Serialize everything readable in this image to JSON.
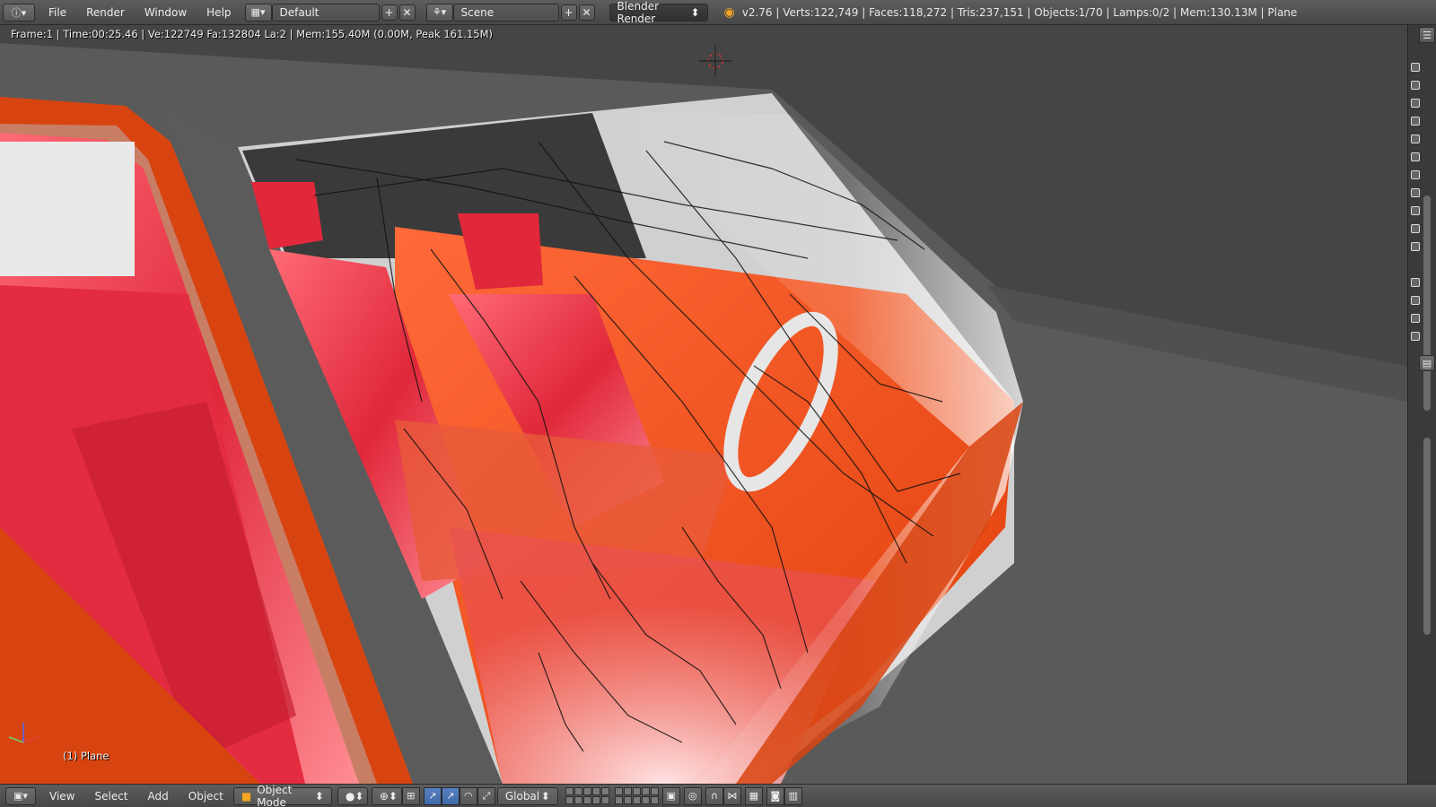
{
  "topbar": {
    "menus": [
      "File",
      "Render",
      "Window",
      "Help"
    ],
    "layout_name": "Default",
    "scene_name": "Scene",
    "engine": "Blender Render",
    "stats": "v2.76 | Verts:122,749 | Faces:118,272 | Tris:237,151 | Objects:1/70 | Lamps:0/2 | Mem:130.13M | Plane"
  },
  "viewport": {
    "render_info": "Frame:1 | Time:00:25.46 | Ve:122749 Fa:132804 La:2 | Mem:155.40M (0.00M, Peak 161.15M)",
    "object_label": "(1) Plane"
  },
  "bottombar": {
    "menus": [
      "View",
      "Select",
      "Add",
      "Object"
    ],
    "mode": "Object Mode",
    "orientation": "Global"
  },
  "colors": {
    "orange": "#e04a10",
    "red_seat": "#e02a3a",
    "grey_body": "#5a5a5a",
    "header": "#4f4f4f"
  },
  "icons": [
    "info-icon",
    "screen-layout-icon",
    "scene-icon",
    "blender-logo-icon",
    "editor-type-icon",
    "object-mode-icon",
    "shading-sphere-icon",
    "pivot-icon",
    "manipulator-icon",
    "render-icon",
    "camera-icon"
  ]
}
